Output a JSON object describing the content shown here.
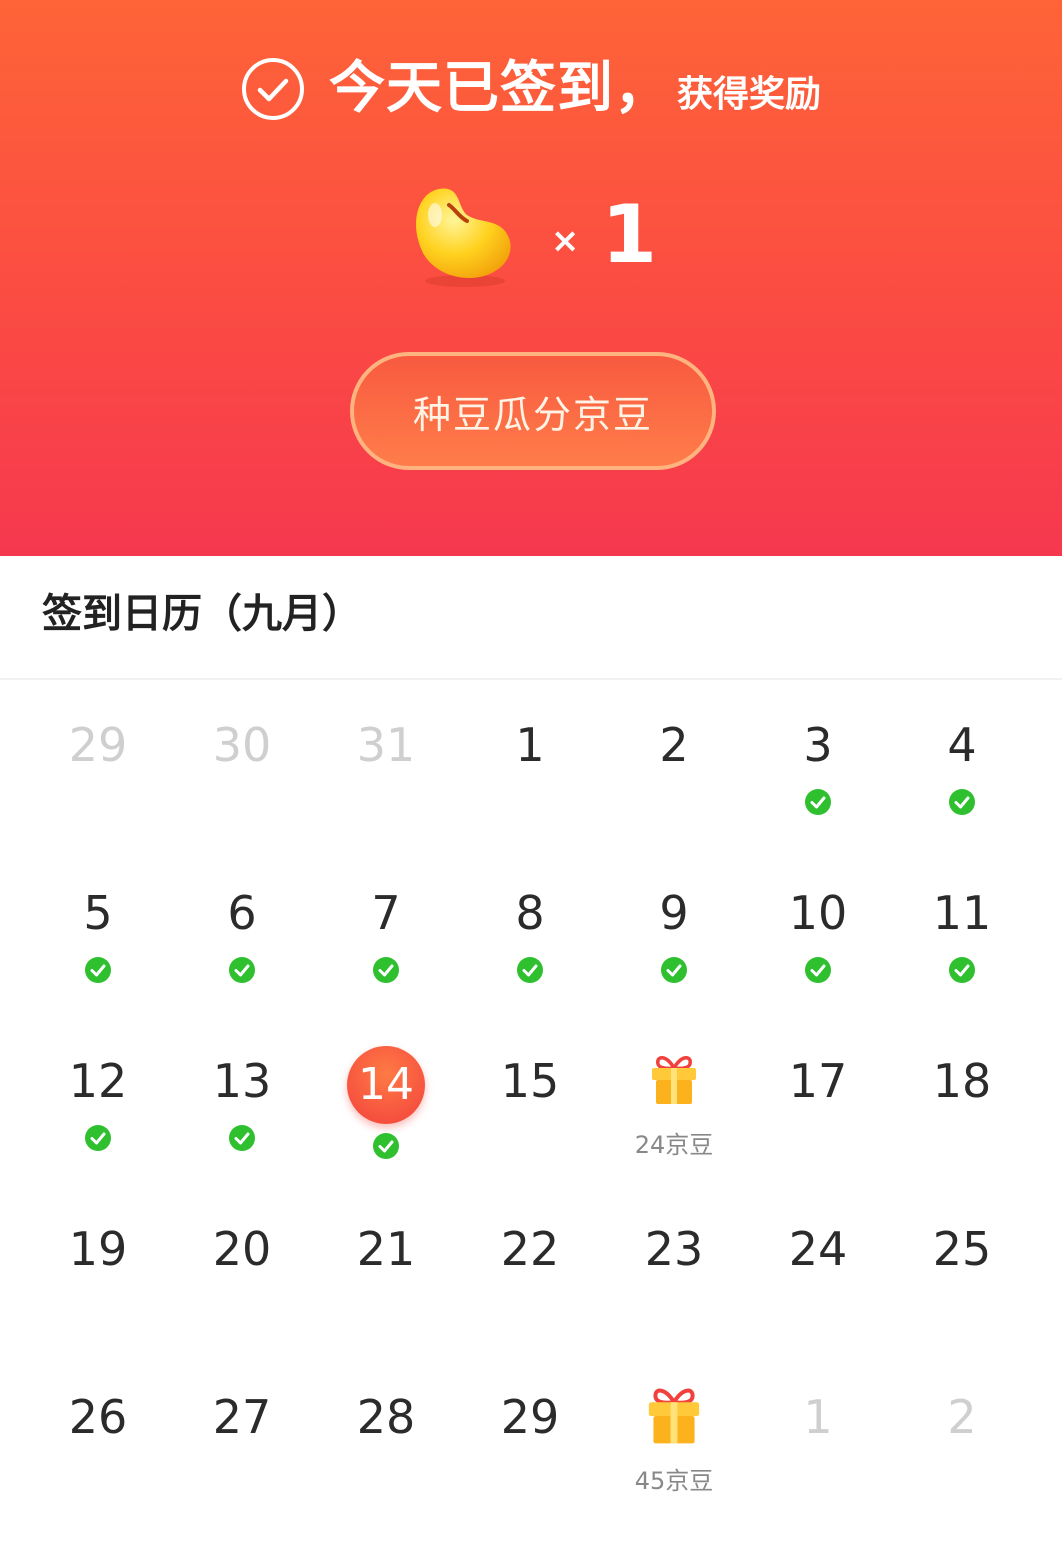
{
  "header": {
    "headline": "今天已签到，",
    "subline": "获得奖励",
    "reward_times": "×",
    "reward_count": "1",
    "cta_label": "种豆瓜分京豆"
  },
  "calendar": {
    "title": "签到日历（九月）",
    "weeks": [
      [
        {
          "day": "29",
          "state": "muted"
        },
        {
          "day": "30",
          "state": "muted"
        },
        {
          "day": "31",
          "state": "muted"
        },
        {
          "day": "1",
          "state": "normal"
        },
        {
          "day": "2",
          "state": "normal"
        },
        {
          "day": "3",
          "state": "checked"
        },
        {
          "day": "4",
          "state": "checked"
        }
      ],
      [
        {
          "day": "5",
          "state": "checked"
        },
        {
          "day": "6",
          "state": "checked"
        },
        {
          "day": "7",
          "state": "checked"
        },
        {
          "day": "8",
          "state": "checked"
        },
        {
          "day": "9",
          "state": "checked"
        },
        {
          "day": "10",
          "state": "checked"
        },
        {
          "day": "11",
          "state": "checked"
        }
      ],
      [
        {
          "day": "12",
          "state": "checked"
        },
        {
          "day": "13",
          "state": "checked"
        },
        {
          "day": "14",
          "state": "today"
        },
        {
          "day": "15",
          "state": "normal"
        },
        {
          "day": "",
          "state": "gift",
          "reward": "24京豆"
        },
        {
          "day": "17",
          "state": "normal"
        },
        {
          "day": "18",
          "state": "normal"
        }
      ],
      [
        {
          "day": "19",
          "state": "normal"
        },
        {
          "day": "20",
          "state": "normal"
        },
        {
          "day": "21",
          "state": "normal"
        },
        {
          "day": "22",
          "state": "normal"
        },
        {
          "day": "23",
          "state": "normal"
        },
        {
          "day": "24",
          "state": "normal"
        },
        {
          "day": "25",
          "state": "normal"
        }
      ],
      [
        {
          "day": "26",
          "state": "normal"
        },
        {
          "day": "27",
          "state": "normal"
        },
        {
          "day": "28",
          "state": "normal"
        },
        {
          "day": "29",
          "state": "normal"
        },
        {
          "day": "",
          "state": "gift-big",
          "reward": "45京豆"
        },
        {
          "day": "1",
          "state": "muted"
        },
        {
          "day": "2",
          "state": "muted"
        }
      ]
    ]
  },
  "colors": {
    "check_green": "#2ec02e",
    "today_red": "#f2413c",
    "gift_gold": "#fbb21d"
  }
}
